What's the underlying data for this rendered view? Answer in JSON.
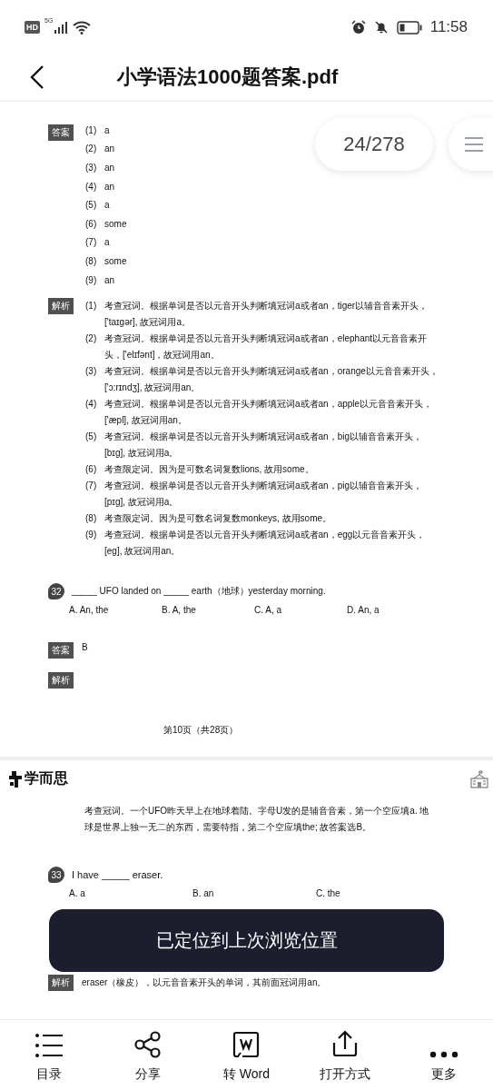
{
  "status_bar": {
    "time": "11:58",
    "network": "5G",
    "badge": "HD"
  },
  "header": {
    "title": "小学语法1000题答案.pdf"
  },
  "page_indicator": "24/278",
  "page_1": {
    "answer_tag": "答案",
    "answers": [
      {
        "num": "(1)",
        "text": "a"
      },
      {
        "num": "(2)",
        "text": "an"
      },
      {
        "num": "(3)",
        "text": "an"
      },
      {
        "num": "(4)",
        "text": "an"
      },
      {
        "num": "(5)",
        "text": "a"
      },
      {
        "num": "(6)",
        "text": "some"
      },
      {
        "num": "(7)",
        "text": "a"
      },
      {
        "num": "(8)",
        "text": "some"
      },
      {
        "num": "(9)",
        "text": "an"
      }
    ],
    "analysis_tag": "解析",
    "analyses": [
      {
        "num": "(1)",
        "text": "考查冠词。根据单词是否以元音开头判断填冠词a或者an，tiger以辅音音素开头，['taɪɡər], 故冠词用a。"
      },
      {
        "num": "(2)",
        "text": "考查冠词。根据单词是否以元音开头判断填冠词a或者an，elephant以元音音素开头，['elɪfənt]，故冠词用an。"
      },
      {
        "num": "(3)",
        "text": "考查冠词。根据单词是否以元音开头判断填冠词a或者an，orange以元音音素开头，['ɔ:rɪndʒ], 故冠词用an。"
      },
      {
        "num": "(4)",
        "text": "考查冠词。根据单词是否以元音开头判断填冠词a或者an，apple以元音音素开头，['æpl], 故冠词用an。"
      },
      {
        "num": "(5)",
        "text": "考查冠词。根据单词是否以元音开头判断填冠词a或者an，big以辅音音素开头，[bɪɡ], 故冠词用a。"
      },
      {
        "num": "(6)",
        "text": "考查限定词。因为是可数名词复数lions, 故用some。"
      },
      {
        "num": "(7)",
        "text": "考查冠词。根据单词是否以元音开头判断填冠词a或者an，pig以辅音音素开头，[pɪɡ], 故冠词用a。"
      },
      {
        "num": "(8)",
        "text": "考查限定词。因为是可数名词复数monkeys, 故用some。"
      },
      {
        "num": "(9)",
        "text": "考查冠词。根据单词是否以元音开头判断填冠词a或者an，egg以元音音素开头，[eɡ], 故冠词用an。"
      }
    ],
    "question": {
      "number": "32",
      "text": "_____ UFO landed on _____ earth（地球）yesterday morning.",
      "options": [
        "A.  An, the",
        "B.  A, the",
        "C.  A, a",
        "D.  An, a"
      ]
    },
    "answer": {
      "tag": "答案",
      "text": "B"
    },
    "analysis_tag_2": "解析",
    "footer": "第10页（共28页）"
  },
  "page_2": {
    "logo": "学而思",
    "analysis_text": "考查冠词。一个UFO昨天早上在地球着陆。字母U发的是辅音音素，第一个空应填a. 地球是世界上独一无二的东西，需要特指，第二个空应填the; 故答案选B。",
    "question": {
      "number": "33",
      "text": "I have _____ eraser.",
      "options": [
        "A.  a",
        "B.  an",
        "C.  the"
      ]
    },
    "analysis": {
      "tag": "解析",
      "text": "eraser（橡皮），以元音音素开头的单词，其前面冠词用an。"
    }
  },
  "toast": "已定位到上次浏览位置",
  "toolbar": [
    {
      "kind": "list",
      "label": "目录"
    },
    {
      "kind": "share",
      "label": "分享"
    },
    {
      "kind": "word",
      "label": "转 Word"
    },
    {
      "kind": "export",
      "label": "打开方式"
    },
    {
      "kind": "more",
      "label": "更多"
    }
  ]
}
